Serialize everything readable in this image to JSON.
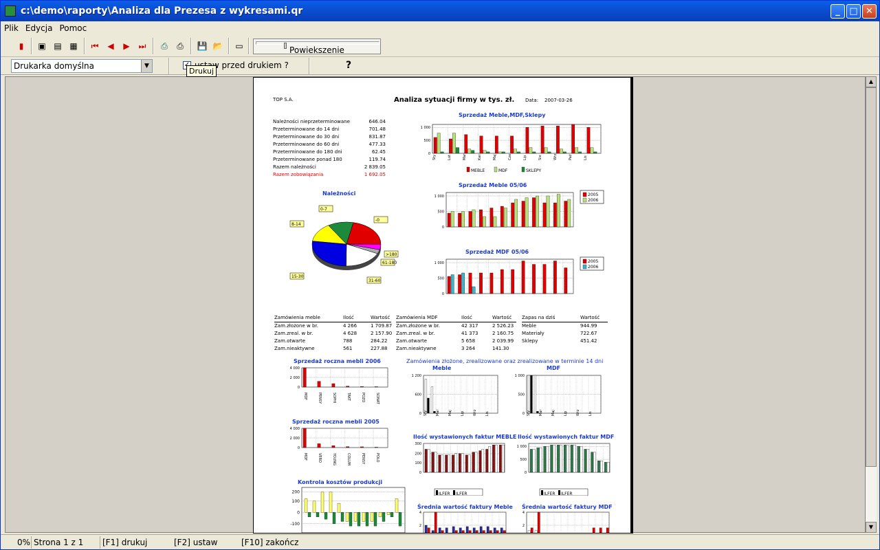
{
  "window": {
    "title": "c:\\demo\\raporty\\Analiza dla Prezesa z wykresami.qr",
    "min": "_",
    "max": "□",
    "close": "✕"
  },
  "menu": [
    "Plik",
    "Edycja",
    "Pomoc"
  ],
  "zoom": {
    "label": "Powiekszenie"
  },
  "options": {
    "printer": "Drukarka domyślna",
    "checkbox_label": "ustaw przed drukiem ?",
    "tooltip": "Drukuj",
    "help": "?"
  },
  "status": {
    "percent": "0%",
    "page": "Strona 1 z 1",
    "f1": "[F1] drukuj",
    "f2": "[F2] ustaw",
    "f10": "[F10] zakończ"
  },
  "report": {
    "company": "TOP S.A.",
    "title": "Analiza sytuacji firmy w tys. zł.",
    "date_label": "Data:",
    "date": "2007-03-26",
    "receivables": [
      [
        "Należności nieprzeterminowane",
        "646.04"
      ],
      [
        "Przeterminowane do 14 dni",
        "701.48"
      ],
      [
        "Przeterminowane do 30 dni",
        "831.87"
      ],
      [
        "Przeterminowane do 60 dni",
        "477.33"
      ],
      [
        "Przeterminowane do 180 dni",
        "62.45"
      ],
      [
        "Przeterminowane ponad 180",
        "119.74"
      ],
      [
        "Razem należności",
        "2 839.05"
      ],
      [
        "Razem zobowiązania",
        "1 692.05"
      ]
    ],
    "pie_title": "Należności",
    "pie_labels": [
      "0-7",
      "8-14",
      "-0",
      ">180",
      "61-180",
      "31-60",
      "15-30"
    ],
    "sales_title": "Sprzedaż Meble,MDF,Sklepy",
    "sales_legend": [
      "MEBLE",
      "MDF",
      "SKLEPY"
    ],
    "meble_title": "Sprzedaż Meble 05/06",
    "mdf_title": "Sprzedaż MDF 05/06",
    "years": [
      "2005",
      "2006"
    ],
    "t1": {
      "h": [
        "Zamówienia meble",
        "Ilość",
        "Wartość"
      ],
      "rows": [
        [
          "Zam.złożone w br.",
          "4 266",
          "1 709.87"
        ],
        [
          "Zam.zreal. w br.",
          "4 628",
          "2 157.90"
        ],
        [
          "Zam.otwarte",
          "788",
          "284.22"
        ],
        [
          "Zam.nieaktywne",
          "561",
          "227.88"
        ]
      ]
    },
    "t2": {
      "h": [
        "Zamówienia MDF",
        "Ilość",
        "Wartość"
      ],
      "rows": [
        [
          "Zam.złożone w br.",
          "42 317",
          "2 526.23"
        ],
        [
          "Zam.zreal. w br.",
          "41 373",
          "2 160.75"
        ],
        [
          "Zam.otwarte",
          "5 658",
          "2 039.99"
        ],
        [
          "Zam.nieaktywne",
          "3 264",
          "141.30"
        ]
      ]
    },
    "t3": {
      "h": [
        "Zapas na dziś",
        "Wartość"
      ],
      "rows": [
        [
          "Meble",
          "944.99"
        ],
        [
          "Materiały",
          "722.67"
        ],
        [
          "Sklepy",
          "451.42"
        ]
      ]
    },
    "annual06": "Sprzedaż roczna mebli 2006",
    "annual05": "Sprzedaż roczna mebli 2005",
    "orders_title": "Zamówienia złożone, zrealizowane oraz zrealizowane w terminie 14 dni",
    "orders_sub1": "Meble",
    "orders_sub2": "MDF",
    "inv_meble": "Ilość wystawionych faktur MEBLE",
    "inv_mdf": "Ilość wystawionych faktur MDF",
    "costs": "Kontrola kosztów produkcji",
    "avg_meble": "Średnia wartość faktury Meble",
    "avg_mdf": "Średnia wartość faktury MDF",
    "inv_legend": [
      "ILFER",
      "ILFER"
    ]
  },
  "colors": {
    "red": "#e00000",
    "green": "#1c8a3a",
    "yellow": "#ffff00",
    "blue": "#0000e0",
    "lime": "#b8e07a",
    "teal": "#3cb4c8"
  }
}
